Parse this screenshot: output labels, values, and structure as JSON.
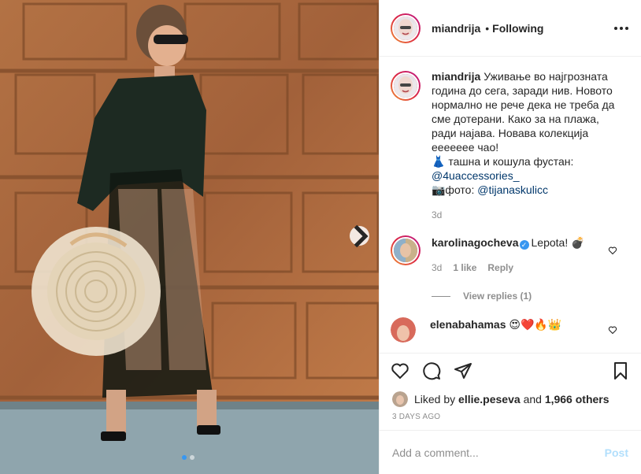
{
  "photo": {
    "next_icon": "chevron-right-icon",
    "slide_count": 2,
    "active_slide": 1
  },
  "header": {
    "username": "miandrija",
    "separator": "•",
    "follow_status": "Following",
    "more_icon": "more-horizontal-icon"
  },
  "caption": {
    "username": "miandrija",
    "text_main": "Уживање во најгрозната година до сега, заради нив. Новото нормално не рече дека не треба да сме дотерани. Како за на плажа, ради најава. Новава колекција ееееееe чао!",
    "line_bag_prefix": "👗 ташна и кошула фустан:",
    "bag_mention": "@4uaccessories_",
    "line_photo_prefix": "📷фото:",
    "photo_mention": "@tijanaskulicc",
    "time": "3d"
  },
  "comments": [
    {
      "username": "karolinagocheva",
      "verified": true,
      "text": "Lepota! 💣",
      "time": "3d",
      "likes": "1 like",
      "reply": "Reply",
      "view_replies": "View replies (1)"
    },
    {
      "username": "elenabahamas",
      "text": "😍❤️🔥👑"
    }
  ],
  "actions": {
    "like_icon": "heart-icon",
    "comment_icon": "comment-icon",
    "share_icon": "paper-plane-icon",
    "save_icon": "bookmark-icon"
  },
  "likes": {
    "prefix": "Liked by",
    "user": "ellie.peseva",
    "and": "and",
    "others": "1,966 others"
  },
  "date": "3 DAYS AGO",
  "add_comment": {
    "placeholder": "Add a comment...",
    "post_label": "Post"
  },
  "colors": {
    "link": "#00376b",
    "accent": "#3897f0",
    "post_disabled": "#b2dffc",
    "muted": "#8e8e8e",
    "wood": "#a8683a"
  }
}
